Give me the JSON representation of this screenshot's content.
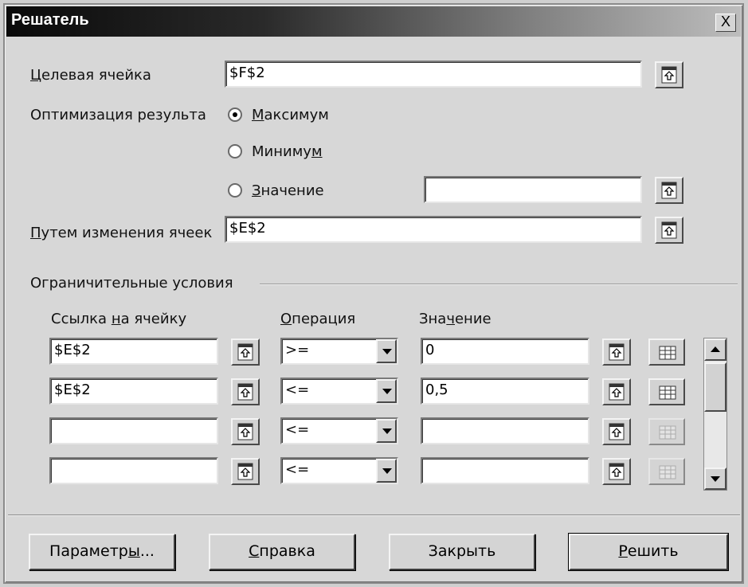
{
  "window": {
    "title": "Решатель",
    "close_glyph": "X"
  },
  "target": {
    "label_u": "Ц",
    "label_rest": "елевая ячейка",
    "value": "$F$2"
  },
  "optimize": {
    "label": "Оптимизация результа",
    "options": [
      {
        "pre": "",
        "u": "М",
        "post": "аксимум",
        "selected": true
      },
      {
        "pre": "Миниму",
        "u": "м",
        "post": "",
        "selected": false
      },
      {
        "pre": "",
        "u": "З",
        "post": "начение",
        "selected": false
      }
    ],
    "value_field": ""
  },
  "changing": {
    "label_u": "П",
    "label_rest": "утем изменения ячеек",
    "value": "$E$2"
  },
  "constraints": {
    "group_label": "Ограничительные условия",
    "col_ref": {
      "pre": "Ссылка ",
      "u": "н",
      "post": "а ячейку"
    },
    "col_op": {
      "pre": "",
      "u": "О",
      "post": "перация"
    },
    "col_val": {
      "pre": "Зна",
      "u": "ч",
      "post": "ение"
    },
    "rows": [
      {
        "ref": "$E$2",
        "op": ">=",
        "val": "0"
      },
      {
        "ref": "$E$2",
        "op": "<=",
        "val": "0,5"
      },
      {
        "ref": "",
        "op": "<=",
        "val": ""
      },
      {
        "ref": "",
        "op": "<=",
        "val": ""
      }
    ]
  },
  "buttons": {
    "params": {
      "pre": "Параметр",
      "u": "ы",
      "post": "..."
    },
    "help": {
      "pre": "",
      "u": "С",
      "post": "правка"
    },
    "close": {
      "pre": "Закрыть",
      "u": "",
      "post": ""
    },
    "solve": {
      "pre": "",
      "u": "Р",
      "post": "ешить"
    }
  },
  "icons": {
    "pick": "shrink-select-icon",
    "grid": "table-grid-icon",
    "scroll_up": "arrow-up-icon",
    "scroll_down": "arrow-down-icon"
  },
  "colors": {
    "title_dark": "#0a0a0a",
    "title_light": "#bdbdbd",
    "dialog_bg": "#d7d7d7"
  }
}
